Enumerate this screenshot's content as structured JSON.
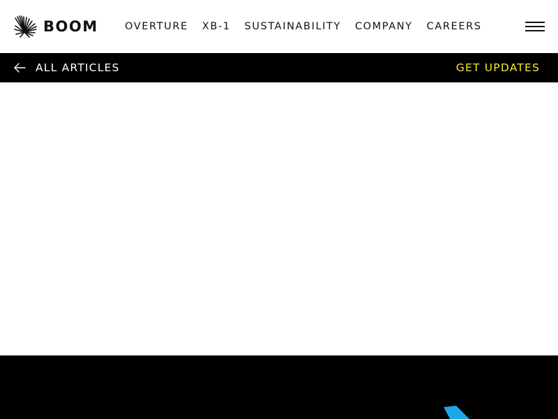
{
  "brand": {
    "name": "BOOM",
    "logo_icon": "boom-starburst-icon"
  },
  "nav": {
    "items": [
      {
        "label": "OVERTURE"
      },
      {
        "label": "XB-1"
      },
      {
        "label": "SUSTAINABILITY"
      },
      {
        "label": "COMPANY"
      },
      {
        "label": "CAREERS"
      }
    ],
    "menu_icon": "hamburger-menu-icon"
  },
  "subbar": {
    "back_label": "ALL ARTICLES",
    "back_icon": "arrow-left-icon",
    "updates_label": "GET UPDATES",
    "updates_color": "#f2e63a"
  },
  "footer": {
    "accent_color": "#1aa9e6"
  }
}
